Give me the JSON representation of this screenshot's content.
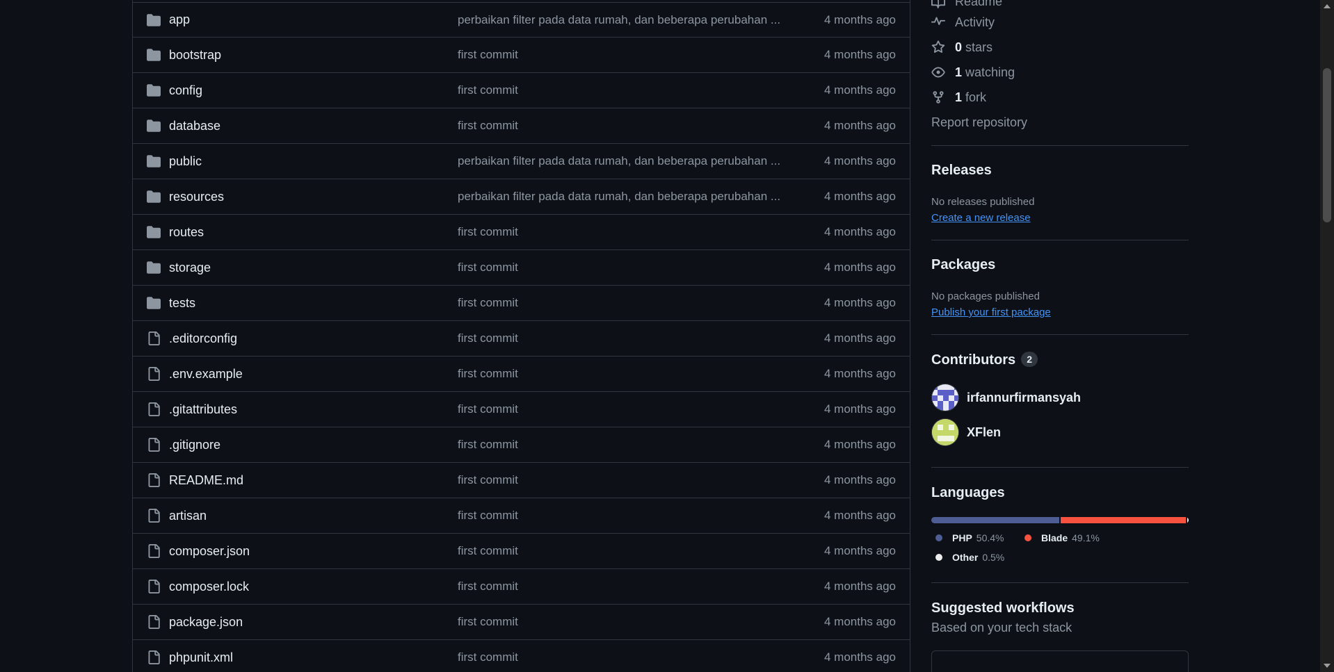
{
  "files": [
    {
      "name": "app",
      "type": "folder",
      "commit": "perbaikan filter pada data rumah, dan beberapa perubahan ...",
      "time": "4 months ago"
    },
    {
      "name": "bootstrap",
      "type": "folder",
      "commit": "first commit",
      "time": "4 months ago"
    },
    {
      "name": "config",
      "type": "folder",
      "commit": "first commit",
      "time": "4 months ago"
    },
    {
      "name": "database",
      "type": "folder",
      "commit": "first commit",
      "time": "4 months ago"
    },
    {
      "name": "public",
      "type": "folder",
      "commit": "perbaikan filter pada data rumah, dan beberapa perubahan ...",
      "time": "4 months ago"
    },
    {
      "name": "resources",
      "type": "folder",
      "commit": "perbaikan filter pada data rumah, dan beberapa perubahan ...",
      "time": "4 months ago"
    },
    {
      "name": "routes",
      "type": "folder",
      "commit": "first commit",
      "time": "4 months ago"
    },
    {
      "name": "storage",
      "type": "folder",
      "commit": "first commit",
      "time": "4 months ago"
    },
    {
      "name": "tests",
      "type": "folder",
      "commit": "first commit",
      "time": "4 months ago"
    },
    {
      "name": ".editorconfig",
      "type": "file",
      "commit": "first commit",
      "time": "4 months ago"
    },
    {
      "name": ".env.example",
      "type": "file",
      "commit": "first commit",
      "time": "4 months ago"
    },
    {
      "name": ".gitattributes",
      "type": "file",
      "commit": "first commit",
      "time": "4 months ago"
    },
    {
      "name": ".gitignore",
      "type": "file",
      "commit": "first commit",
      "time": "4 months ago"
    },
    {
      "name": "README.md",
      "type": "file",
      "commit": "first commit",
      "time": "4 months ago"
    },
    {
      "name": "artisan",
      "type": "file",
      "commit": "first commit",
      "time": "4 months ago"
    },
    {
      "name": "composer.json",
      "type": "file",
      "commit": "first commit",
      "time": "4 months ago"
    },
    {
      "name": "composer.lock",
      "type": "file",
      "commit": "first commit",
      "time": "4 months ago"
    },
    {
      "name": "package.json",
      "type": "file",
      "commit": "first commit",
      "time": "4 months ago"
    },
    {
      "name": "phpunit.xml",
      "type": "file",
      "commit": "first commit",
      "time": "4 months ago"
    }
  ],
  "sidebar": {
    "readme_label": "Readme",
    "activity_label": "Activity",
    "stars_count": "0",
    "stars_label": "stars",
    "watching_count": "1",
    "watching_label": "watching",
    "fork_count": "1",
    "fork_label": "fork",
    "report_label": "Report repository",
    "releases": {
      "title": "Releases",
      "empty": "No releases published",
      "link": "Create a new release"
    },
    "packages": {
      "title": "Packages",
      "empty": "No packages published",
      "link": "Publish your first package"
    },
    "contributors": {
      "title": "Contributors",
      "count": "2",
      "people": [
        {
          "name": "irfannurfirmansyah",
          "avatar_color": "#5a5fc7"
        },
        {
          "name": "XFlen",
          "avatar_color": "#c4d86a"
        }
      ]
    },
    "languages": {
      "title": "Languages",
      "items": [
        {
          "name": "PHP",
          "percent": "50.4%",
          "value": 50.4,
          "color": "#4F5D95"
        },
        {
          "name": "Blade",
          "percent": "49.1%",
          "value": 49.1,
          "color": "#f7523f"
        },
        {
          "name": "Other",
          "percent": "0.5%",
          "value": 0.5,
          "color": "#ededed"
        }
      ]
    },
    "workflows": {
      "title": "Suggested workflows",
      "subtitle": "Based on your tech stack"
    }
  },
  "colors": {
    "background": "#0d1117",
    "border": "#30363d",
    "text": "#e6edf3",
    "muted": "#8d96a0",
    "link": "#4493f8"
  }
}
